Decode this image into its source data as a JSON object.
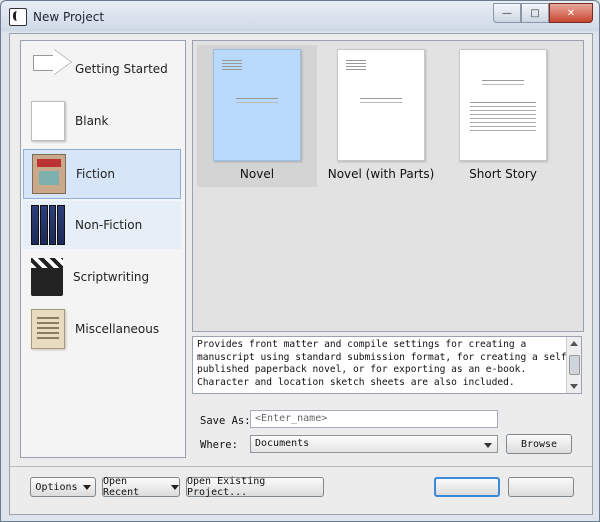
{
  "window": {
    "title": "New Project"
  },
  "sidebar": {
    "items": [
      {
        "label": "Getting Started",
        "icon": "arrow-icon"
      },
      {
        "label": "Blank",
        "icon": "blank-page-icon"
      },
      {
        "label": "Fiction",
        "icon": "fiction-book-icon"
      },
      {
        "label": "Non-Fiction",
        "icon": "books-icon"
      },
      {
        "label": "Scriptwriting",
        "icon": "clapperboard-icon"
      },
      {
        "label": "Miscellaneous",
        "icon": "notes-icon"
      }
    ],
    "selected": "Fiction"
  },
  "templates": [
    {
      "label": "Novel"
    },
    {
      "label": "Novel (with Parts)"
    },
    {
      "label": "Short Story"
    }
  ],
  "description": {
    "line1": "Provides front matter and compile settings for creating a",
    "line2": "manuscript using standard submission format, for creating a self-",
    "line3": "published paperback novel, or for exporting as an e-book.",
    "line4": "Character and location sketch sheets are also included."
  },
  "form": {
    "save_as_label": "Save As:",
    "save_as_placeholder": "<Enter_name>",
    "where_label": "Where:",
    "where_value": "Documents",
    "browse_label": "Browse"
  },
  "footer": {
    "options_label": "Options",
    "open_recent_label": "Open Recent",
    "open_existing_label": "Open Existing Project..."
  },
  "colors": {
    "selection": "#d6e6f8",
    "accent": "#3a8ad8"
  }
}
